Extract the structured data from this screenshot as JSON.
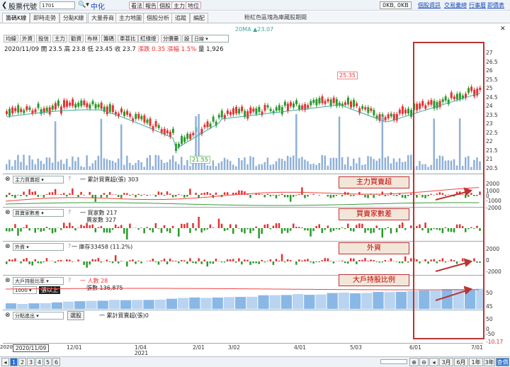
{
  "topbar": {
    "stock_label": "股票代號",
    "code": "1701",
    "name": "中化",
    "action_buttons": [
      "看法",
      "報告",
      "個股",
      "主力",
      "地位"
    ],
    "status": "0KB, 0KB",
    "links": [
      "個股資訊",
      "交易彙總",
      "行事曆",
      "即價表"
    ]
  },
  "tabs": [
    "籌碼K線",
    "即時走勢",
    "分點K線",
    "大量券商",
    "主力地圖",
    "個股分析",
    "追蹤",
    "編配"
  ],
  "tab_notice": "粉紅色區塊為庫藏股期間",
  "ma_legend": "20MA ▲23.07",
  "toolbar": [
    "均線",
    "外資",
    "投信",
    "主力",
    "勸資",
    "布林",
    "籌碼",
    "車甚比",
    "紅綠燈",
    "分價量",
    "設",
    "日線"
  ],
  "ohlc": {
    "date": "2020/11/09",
    "open_label": "開",
    "open": "23.5",
    "high_label": "高",
    "high": "23.8",
    "low_label": "低",
    "low": "23.45",
    "close_label": "收",
    "close": "23.7",
    "chg_label": "漲跌",
    "chg": "0.35",
    "pct_label": "漲幅",
    "pct": "1.5%",
    "vol_label": "量",
    "vol": "1,926"
  },
  "price_axis": [
    "27",
    "26.5",
    "26",
    "25.5",
    "25",
    "24.5",
    "24",
    "23.5",
    "23",
    "22.5",
    "22",
    "21.5",
    "21",
    "20.5"
  ],
  "price_callouts": {
    "high": "25.35",
    "low": "21.55"
  },
  "panels": {
    "p1": {
      "select": "主力買賣超",
      "legend": "一 累計買賣超(張) 303",
      "axis": [
        "2000",
        "1000",
        "0",
        "-1000",
        "-2000"
      ],
      "ann": "主力買賣超"
    },
    "p2": {
      "select": "買賣家數差",
      "legend1": "一 買家數 217",
      "legend2": "賣家數 327",
      "ann": "買賣家數差"
    },
    "p3": {
      "select": "外資",
      "legend": "一 庫存33458 (11.2%)",
      "axis": [
        "2000",
        "0",
        "-2000"
      ],
      "ann": "外資"
    },
    "p4": {
      "select": "大戶持股比率",
      "qty": "1000",
      "qty_unit": "張以上",
      "legend1": "一 人數 28",
      "legend2": "張數 136,875",
      "axis": [
        "50",
        "45"
      ],
      "ann": "大戶持股比例"
    },
    "p5": {
      "select": "分點進出",
      "btn": "選股",
      "legend": "一 累計買賣超(張)0",
      "axis": [
        "50",
        "0",
        "-50"
      ],
      "bottom_value": "-10.17"
    }
  },
  "x_axis": {
    "start": "2020/11/09",
    "labels": [
      "12/01",
      "1/04",
      "2/01",
      "3/02",
      "4/01",
      "5/03",
      "6/01",
      "7/01"
    ],
    "year": "2021",
    "left_year": "2020"
  },
  "bottom": {
    "pages": [
      "1",
      "2",
      "3",
      "4",
      "5",
      "6"
    ],
    "ranges": [
      "3月",
      "6月",
      "1年",
      "3年"
    ],
    "ok": "查價"
  },
  "colors": {
    "up": "#e33333",
    "down": "#2a9a2a",
    "ma": "#3aa99a",
    "ann_border": "#b33333"
  }
}
